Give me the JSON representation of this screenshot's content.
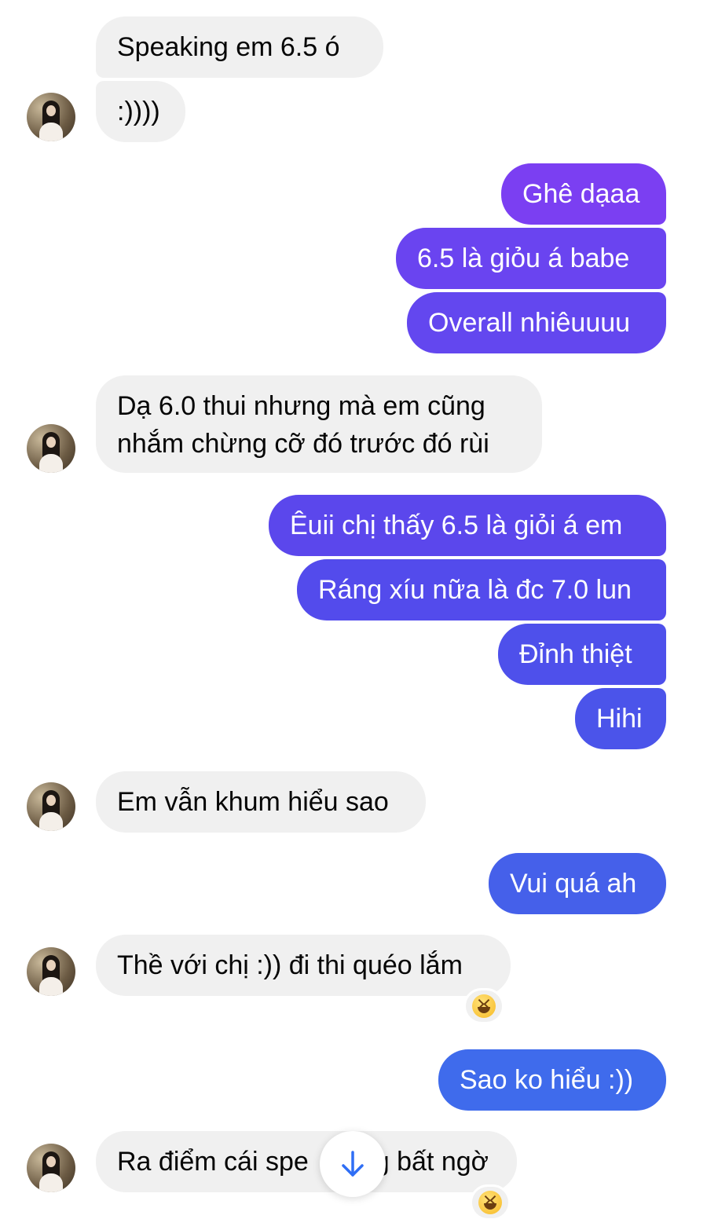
{
  "colors": {
    "incoming_bg": "#f0f0f0",
    "outgoing_gradient": [
      "#7b3ff2",
      "#5b47ec",
      "#4a5bea",
      "#3f6bec"
    ],
    "scroll_arrow": "#2f6ef5"
  },
  "messages": [
    {
      "side": "in",
      "text": "Speaking em  6.5 ó"
    },
    {
      "side": "in",
      "text": ":))))"
    },
    {
      "side": "out",
      "text": "Ghê dạaa"
    },
    {
      "side": "out",
      "text": "6.5 là giỏu á babe"
    },
    {
      "side": "out",
      "text": "Overall nhiêuuuu"
    },
    {
      "side": "in",
      "line1": "Dạ 6.0 thui nhưng mà em cũng",
      "line2": "nhắm chừng cỡ đó trước đó rùi"
    },
    {
      "side": "out",
      "text": "Êuii chị thấy 6.5 là giỏi á em"
    },
    {
      "side": "out",
      "text": "Ráng xíu nữa là đc 7.0 lun"
    },
    {
      "side": "out",
      "text": "Đỉnh thiệt"
    },
    {
      "side": "out",
      "text": "Hihi"
    },
    {
      "side": "in",
      "text": "Em vẫn khum hiểu sao"
    },
    {
      "side": "out",
      "text": "Vui quá ah"
    },
    {
      "side": "in",
      "text": "Thề với chị :)) đi thi quéo lắm",
      "reaction": "laughing-emoji"
    },
    {
      "side": "out",
      "text": "Sao ko hiểu :))"
    },
    {
      "side": "in",
      "text": "Ra điểm cái spe",
      "text_after": "g bất ngờ",
      "reaction": "laughing-emoji"
    }
  ],
  "scroll_button": {
    "icon": "arrow-down-icon"
  }
}
